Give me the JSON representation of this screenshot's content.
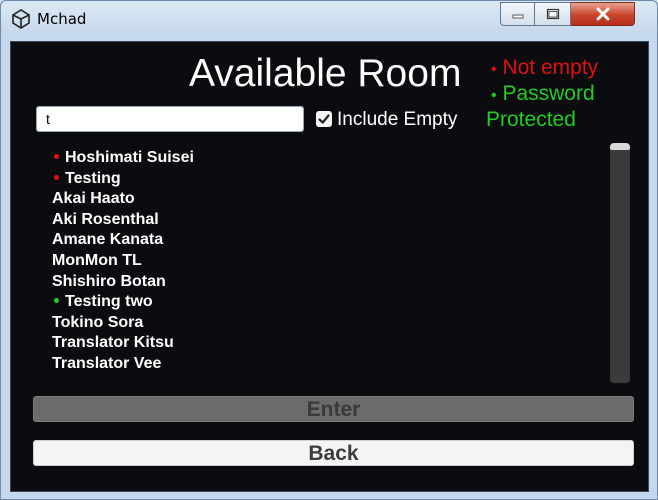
{
  "window": {
    "title": "Mchad"
  },
  "header": {
    "title": "Available Room"
  },
  "legend": {
    "not_empty": "Not empty",
    "password": "Password",
    "protected": "Protected",
    "not_empty_color": "#e01010",
    "password_color": "#22cc22"
  },
  "search": {
    "value": "t"
  },
  "include_empty": {
    "label": "Include Empty",
    "checked": true
  },
  "rooms": [
    {
      "name": "Hoshimati Suisei",
      "marker": "red"
    },
    {
      "name": "Testing",
      "marker": "red"
    },
    {
      "name": "Akai Haato",
      "marker": "none"
    },
    {
      "name": "Aki Rosenthal",
      "marker": "none"
    },
    {
      "name": "Amane Kanata",
      "marker": "none"
    },
    {
      "name": "MonMon TL",
      "marker": "none"
    },
    {
      "name": "Shishiro Botan",
      "marker": "none"
    },
    {
      "name": "Testing two",
      "marker": "green"
    },
    {
      "name": "Tokino Sora",
      "marker": "none"
    },
    {
      "name": "Translator Kitsu",
      "marker": "none"
    },
    {
      "name": "Translator Vee",
      "marker": "none"
    }
  ],
  "buttons": {
    "enter": "Enter",
    "back": "Back"
  },
  "icons": {
    "app": "unity-icon",
    "minimize": "minimize-icon",
    "maximize": "maximize-icon",
    "close": "close-icon"
  }
}
